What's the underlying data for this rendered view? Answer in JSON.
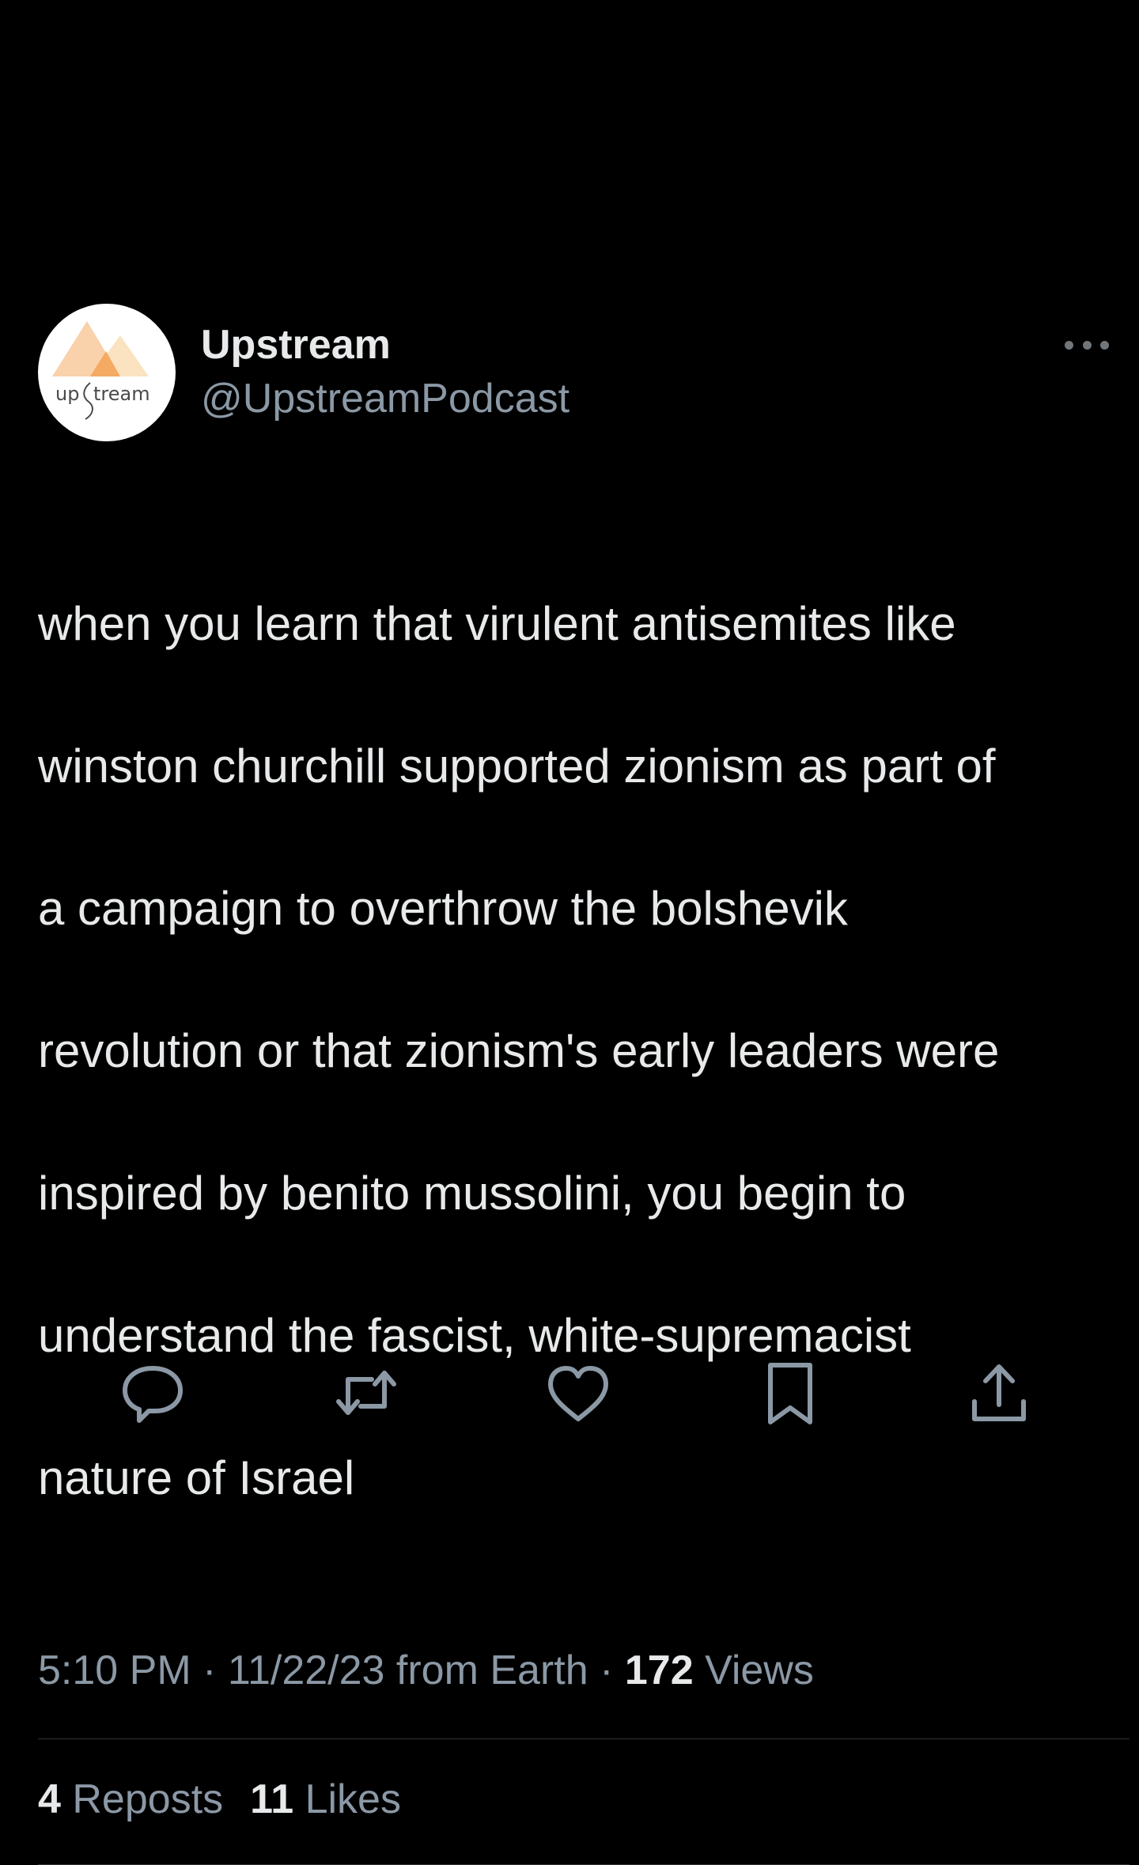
{
  "tweet": {
    "display_name": "Upstream",
    "handle": "@UpstreamPodcast",
    "avatar_logo_text": "upstream",
    "text_lines": [
      "when you learn that virulent antisemites like",
      "winston churchill supported zionism as part of",
      "a campaign to overthrow the bolshevik",
      "revolution or that zionism's early leaders were",
      "inspired by benito mussolini, you begin to",
      "understand the fascist, white-supremacist",
      "nature of Israel"
    ],
    "time": "5:10 PM",
    "date": "11/22/23",
    "source": "from Earth",
    "separator": "·",
    "views_count": "172",
    "views_label": "Views"
  },
  "stats": {
    "reposts_count": "4",
    "reposts_label": "Reposts",
    "likes_count": "11",
    "likes_label": "Likes"
  },
  "icons": {
    "more": "more-horizontal-icon",
    "reply": "reply-icon",
    "repost": "repost-icon",
    "like": "like-icon",
    "bookmark": "bookmark-icon",
    "share": "share-icon"
  },
  "colors": {
    "background": "#000000",
    "primary_text": "#e7e9ea",
    "secondary_text": "#8b98a5",
    "divider": "#2f3336",
    "logo_peach": "#f8c79a",
    "logo_orange": "#f6b06d"
  }
}
